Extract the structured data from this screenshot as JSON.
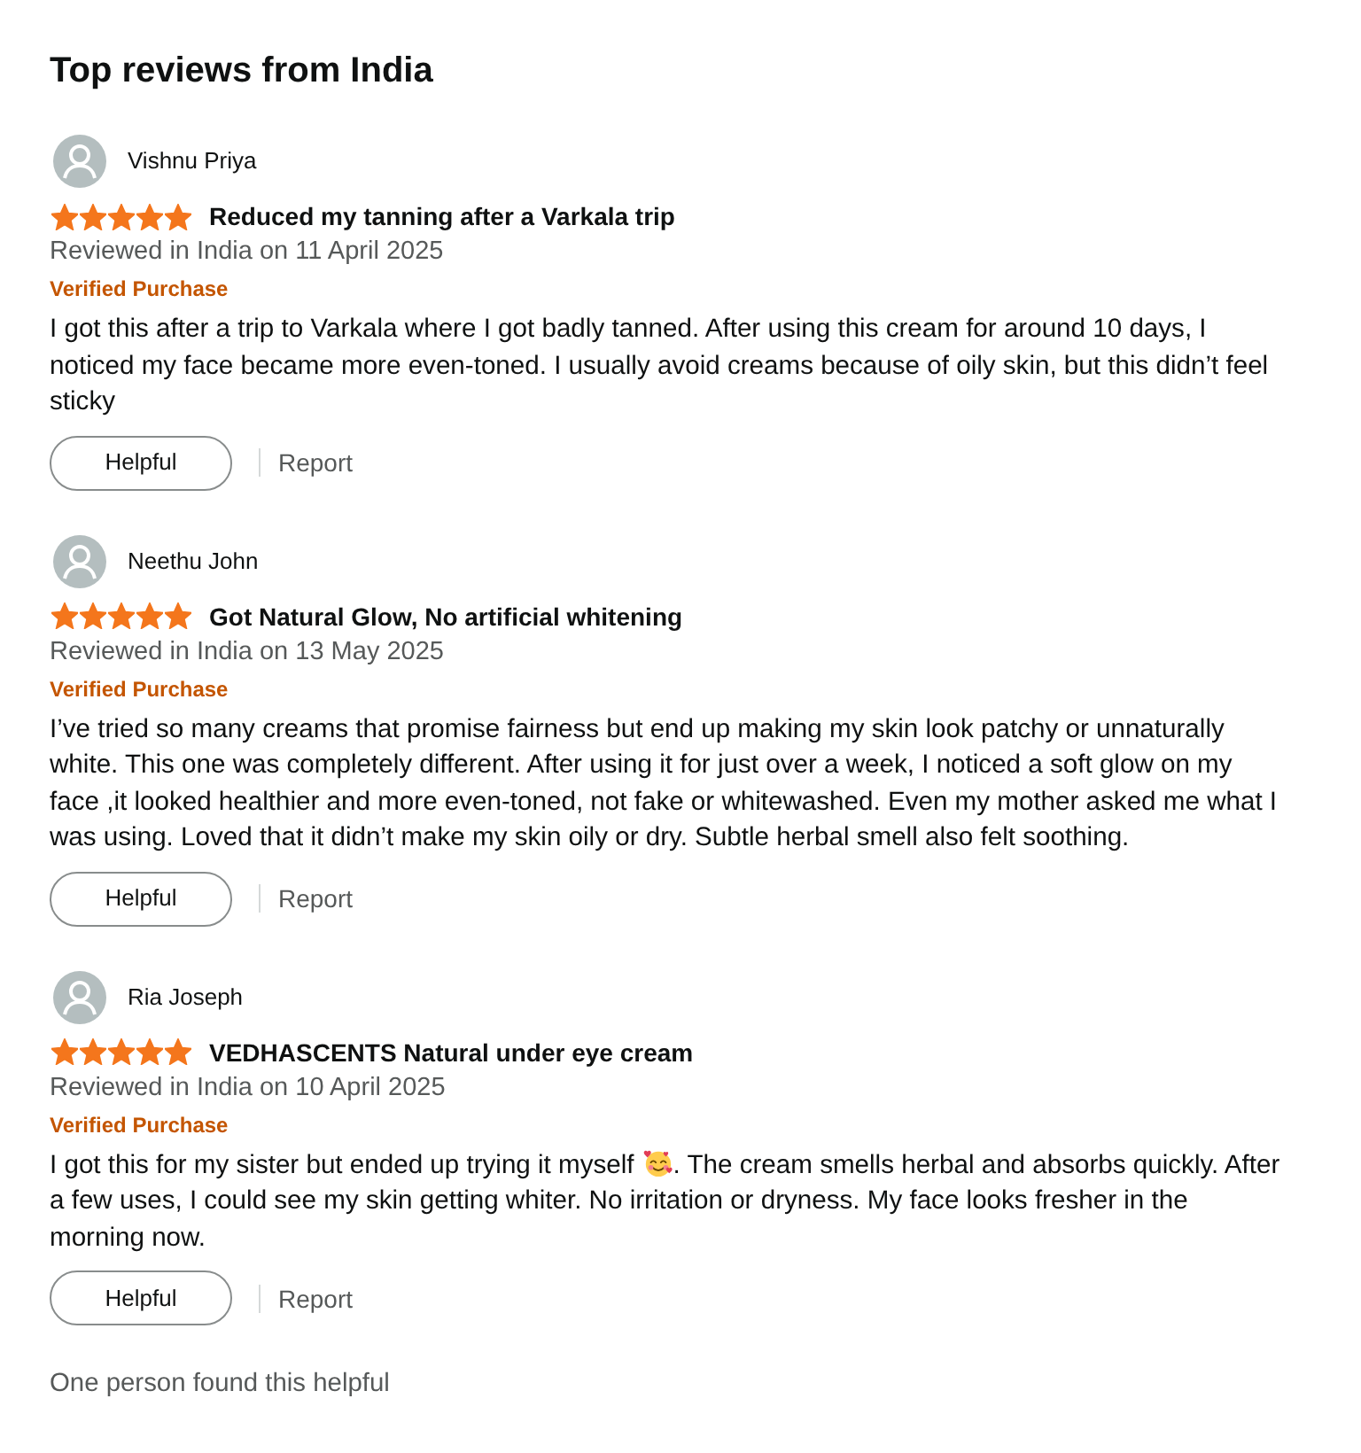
{
  "section": {
    "title": "Top reviews from India"
  },
  "reviews": [
    {
      "author": "Vishnu Priya",
      "stars": 5,
      "title": "Reduced my tanning after a Varkala trip",
      "date": "Reviewed in India on 11 April 2025",
      "badge": "Verified Purchase",
      "body": [
        {
          "kind": "text",
          "text": "I got this after a trip to Varkala where I got badly tanned. After using this cream for around 10 days, I noticed my face became more even-toned. I usually avoid creams because of oily skin, but this didn’t feel sticky"
        }
      ],
      "actions": {
        "helpful": "Helpful",
        "report": "Report"
      }
    },
    {
      "author": "Neethu John",
      "stars": 5,
      "title": "Got Natural Glow, No artificial whitening",
      "date": "Reviewed in India on 13 May 2025",
      "badge": "Verified Purchase",
      "body": [
        {
          "kind": "text",
          "text": "I’ve tried so many creams that promise fairness but end up making my skin look patchy or unnaturally white. This one was completely different. After using it for just over a week, I noticed a soft glow on my face ,it looked healthier and more even-toned, not fake or whitewashed. Even my mother asked me what I was using. Loved that it didn’t make my skin oily or dry. Subtle herbal smell also felt soothing."
        }
      ],
      "actions": {
        "helpful": "Helpful",
        "report": "Report"
      }
    },
    {
      "author": "Ria Joseph",
      "stars": 5,
      "title": "VEDHASCENTS Natural under eye cream",
      "date": "Reviewed in India on 10 April 2025",
      "badge": "Verified Purchase",
      "body": [
        {
          "kind": "text",
          "text": "I got this for my sister but ended up trying it myself"
        },
        {
          "kind": "emoji"
        },
        {
          "kind": "text",
          "text": ". The cream smells herbal and absorbs quickly. After a few uses, I could see my skin getting whiter. No irritation or dryness. My face looks fresher in the morning now."
        }
      ],
      "actions": {
        "helpful": "Helpful",
        "report": "Report"
      },
      "helpful_note": "One person found this helpful"
    }
  ]
}
